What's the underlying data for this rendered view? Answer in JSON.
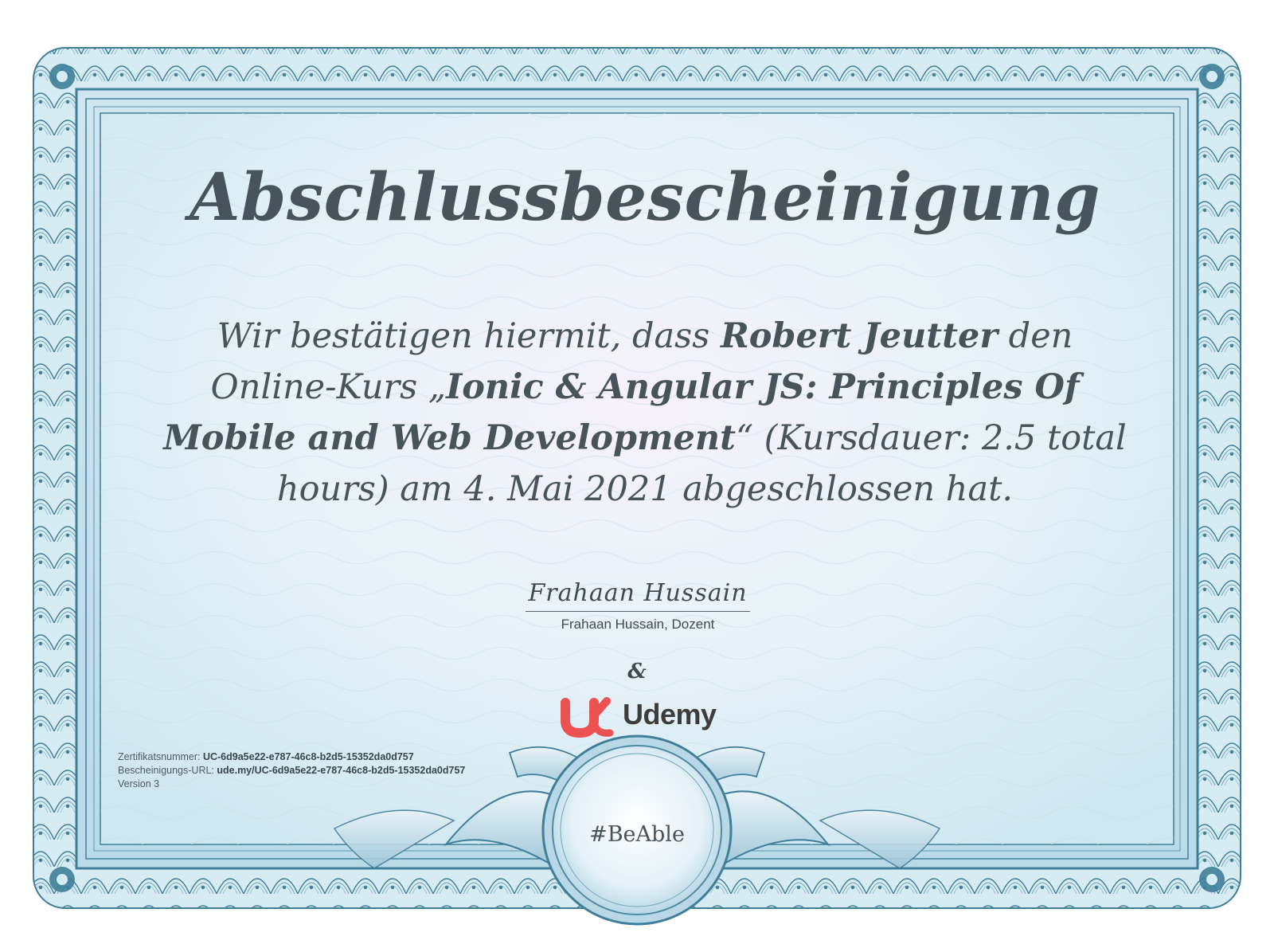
{
  "certificate": {
    "title": "Abschlussbescheinigung",
    "statement": {
      "part1": "Wir bestätigen hiermit, dass ",
      "student_name": "Robert Jeutter",
      "part2": " den Online-Kurs „",
      "course_title": "Ionic & Angular JS: Principles Of Mobile and Web Development",
      "part3": "“ (Kursdauer: 2.5 total hours) am 4. Mai 2021 abgeschlossen hat."
    },
    "signature": {
      "script": "Frahaan Hussain",
      "caption": "Frahaan Hussain, Dozent"
    },
    "ampersand": "&",
    "brand": {
      "name": "Udemy",
      "logo_icon": "udemy-u-logo",
      "accent_color": "#ec5252",
      "text_color": "#3e3d3a"
    },
    "meta": {
      "certificate_number_label": "Zertifikatsnummer: ",
      "certificate_number": "UC-6d9a5e22-e787-46c8-b2d5-15352da0d757",
      "url_label": "Bescheinigungs-URL: ",
      "url": "ude.my/UC-6d9a5e22-e787-46c8-b2d5-15352da0d757",
      "version": "Version 3"
    },
    "seal": {
      "text": "#BeAble"
    },
    "colors": {
      "border_blue": "#3f7f99",
      "border_light": "#a9d3e2",
      "inner_background": "#dbeef6",
      "heading_text": "#47545c"
    }
  }
}
